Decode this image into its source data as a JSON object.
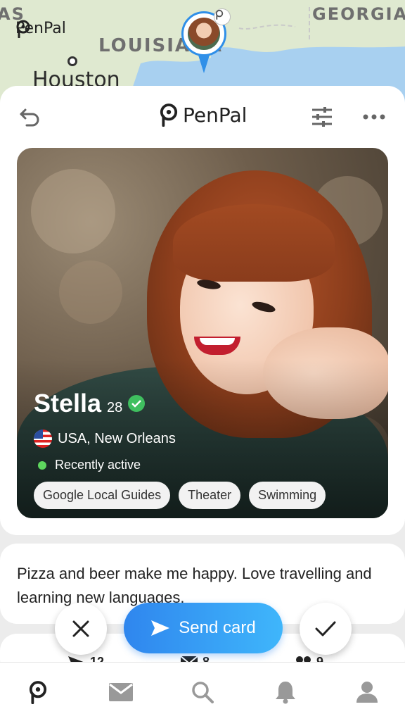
{
  "map": {
    "labels": [
      "AS",
      "GEORGIA",
      "LOUISIANA"
    ],
    "city": "Houston",
    "logo_text": "PenPal"
  },
  "header": {
    "brand": "PenPal",
    "back_icon": "undo-icon",
    "filter_icon": "sliders-icon",
    "more_icon": "more-dots-icon"
  },
  "profile": {
    "name": "Stella",
    "age": "28",
    "location": "USA, New Orleans",
    "status": "Recently active",
    "tags": [
      "Google Local Guides",
      "Theater",
      "Swimming"
    ]
  },
  "bio": "Pizza and beer make me happy. Love travelling and learning new languages.",
  "stats": [
    {
      "icon": "send-icon",
      "value": "12"
    },
    {
      "icon": "mail-icon",
      "value": "8"
    },
    {
      "icon": "people-icon",
      "value": "9"
    }
  ],
  "actions": {
    "dismiss_icon": "close-icon",
    "send_label": "Send card",
    "accept_icon": "check-icon"
  },
  "nav": [
    "penpal-icon",
    "mail-icon",
    "search-icon",
    "bell-icon",
    "profile-icon"
  ],
  "colors": {
    "accent_start": "#2f86ee",
    "accent_end": "#3fb6fb",
    "verified": "#3fbf5f",
    "active_dot": "#5ed65e"
  }
}
